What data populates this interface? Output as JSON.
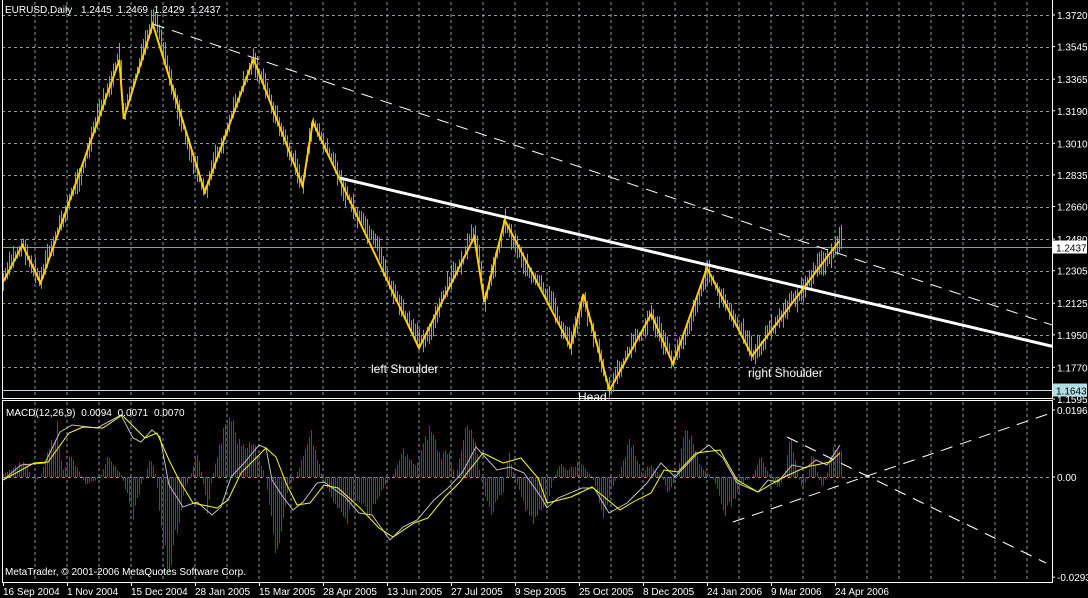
{
  "window": {
    "symbol_timeframe": "EURUSD,Daily",
    "ohlc": [
      "1.2445",
      "1.2469",
      "1.2429",
      "1.2437"
    ]
  },
  "price_axis": {
    "ticks": [
      "1.3720",
      "1.3545",
      "1.3365",
      "1.3190",
      "1.3010",
      "1.2835",
      "1.2660",
      "1.2480",
      "1.2305",
      "1.2125",
      "1.1950",
      "1.1770",
      "1.1595"
    ],
    "current_price": "1.2437",
    "marked_level": "1.1643"
  },
  "macd": {
    "label": "MACD(12,26,9)",
    "values": [
      "0.0094",
      "0.0071",
      "0.0070"
    ],
    "axis_ticks": [
      "0.0196",
      "0.00",
      "-0.0293"
    ]
  },
  "date_axis": {
    "labels": [
      "16 Sep 2004",
      "1 Nov 2004",
      "15 Dec 2004",
      "28 Jan 2005",
      "15 Mar 2005",
      "28 Apr 2005",
      "13 Jun 2005",
      "27 Jul 2005",
      "9 Sep 2005",
      "25 Oct 2005",
      "8 Dec 2005",
      "24 Jan 2006",
      "9 Mar 2006",
      "24 Apr 2006"
    ]
  },
  "annotations": {
    "left_shoulder": "left Shoulder",
    "head": "Head",
    "right_shoulder": "right Shoulder"
  },
  "copyright": "MetaTrader, © 2001-2006 MetaQuotes Software Corp.",
  "colors": {
    "background": "#000000",
    "grid": "#8c9aa8",
    "bars": "#33dd22",
    "zigzag": "#ffd000",
    "trendline": "#ffffff",
    "current_price_line": "#8c9aa8",
    "marked_level_line": "#b0e0e6",
    "macd_main": "#c0c0c0",
    "macd_signal": "#ffff00",
    "histogram_up": "#ff0000",
    "histogram_down": "#008000"
  },
  "chart_data": {
    "type": "line",
    "ylim": [
      1.1595,
      1.372
    ],
    "zigzag": [
      [
        "2004-09-16",
        1.2242
      ],
      [
        "2004-09-30",
        1.2447
      ],
      [
        "2004-10-13",
        1.2237
      ],
      [
        "2004-12-07",
        1.3471
      ],
      [
        "2004-12-10",
        1.3144
      ],
      [
        "2004-12-30",
        1.367
      ],
      [
        "2005-02-04",
        1.274
      ],
      [
        "2005-03-11",
        1.3477
      ],
      [
        "2005-04-14",
        1.2774
      ],
      [
        "2005-04-21",
        1.3128
      ],
      [
        "2005-07-05",
        1.1877
      ],
      [
        "2005-08-12",
        1.2491
      ],
      [
        "2005-08-19",
        1.2132
      ],
      [
        "2005-09-02",
        1.2585
      ],
      [
        "2005-10-19",
        1.1883
      ],
      [
        "2005-10-28",
        1.2176
      ],
      [
        "2005-11-15",
        1.1643
      ],
      [
        "2005-12-14",
        1.2065
      ],
      [
        "2005-12-30",
        1.1789
      ],
      [
        "2006-01-24",
        1.232
      ],
      [
        "2006-02-24",
        1.1833
      ],
      [
        "2006-04-27",
        1.2469
      ]
    ],
    "trendlines": [
      {
        "style": "solid",
        "points": [
          [
            "2005-05-10",
            1.2818
          ],
          [
            "2006-09-23",
            1.1894
          ]
        ]
      },
      {
        "style": "dashed",
        "points": [
          [
            "2004-12-30",
            1.367
          ],
          [
            "2006-09-23",
            1.2015
          ]
        ]
      }
    ]
  }
}
